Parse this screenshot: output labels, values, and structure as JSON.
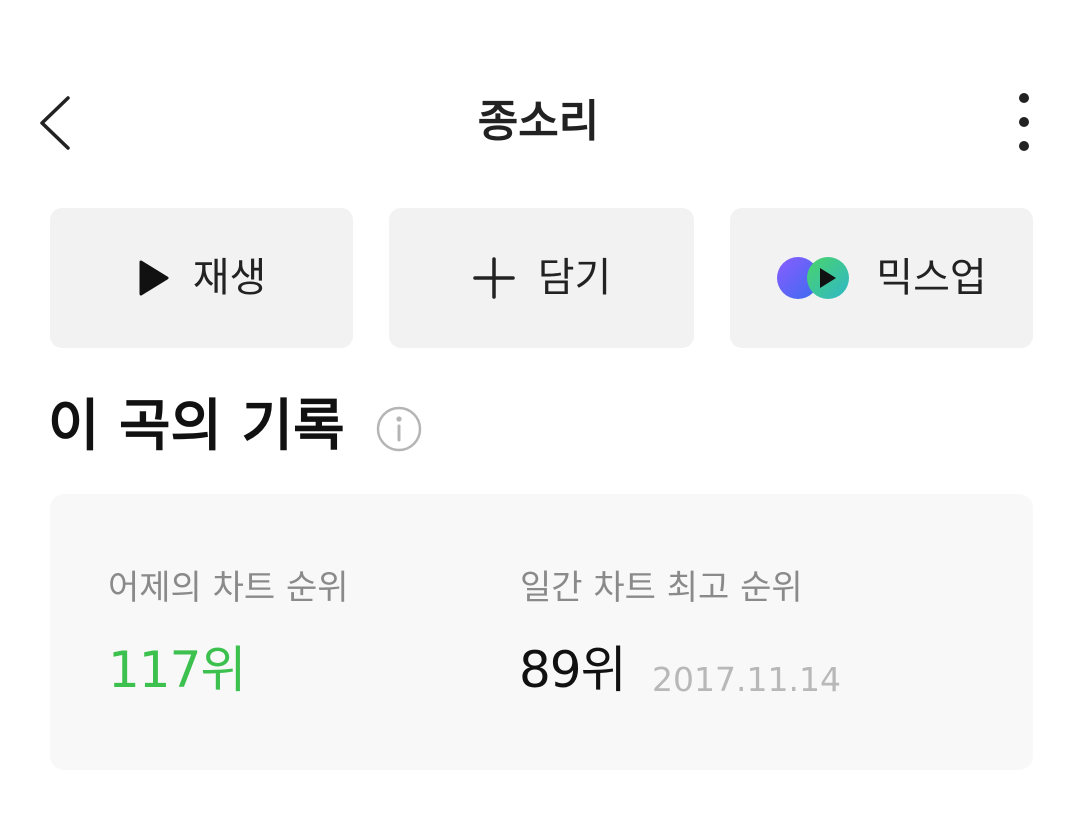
{
  "header": {
    "title": "종소리",
    "back_icon": "chevron-left-icon",
    "more_icon": "more-vertical-icon"
  },
  "actions": {
    "play_label": "재생",
    "add_label": "담기",
    "mixup_label": "믹스업"
  },
  "record_section": {
    "title": "이 곡의 기록",
    "info_icon": "info-icon"
  },
  "record_card": {
    "yesterday_label": "어제의 차트 순위",
    "yesterday_value": "117위",
    "peak_label": "일간 차트 최고 순위",
    "peak_value": "89위",
    "peak_date": "2017.11.14"
  },
  "colors": {
    "accent_green": "#3cc14e",
    "button_bg": "#f2f2f2",
    "card_bg": "#f8f8f8"
  }
}
